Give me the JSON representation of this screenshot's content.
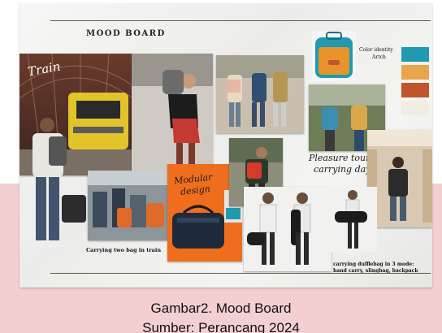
{
  "board": {
    "title": "MOOD BOARD",
    "train_label": "Train",
    "color_identity_line1": "Color identity",
    "color_identity_line2": "Artch",
    "modular_line1": "Modular",
    "modular_line2": "design",
    "pleasure_line1": "Pleasure tourism",
    "pleasure_line2": "carrying daypack",
    "carrying_two": "Carrying two bag in train",
    "duffle_line1": "carrying dufflebag in 3 mode:",
    "duffle_line2": "hand carry, slingbag, backpack",
    "swatches": [
      "#1f9ab0",
      "#e8a54a",
      "#c0542a",
      "#f1ede4"
    ]
  },
  "caption": {
    "line1": "Gambar2. Mood Board",
    "line2": "Sumber: Perancang 2024"
  }
}
